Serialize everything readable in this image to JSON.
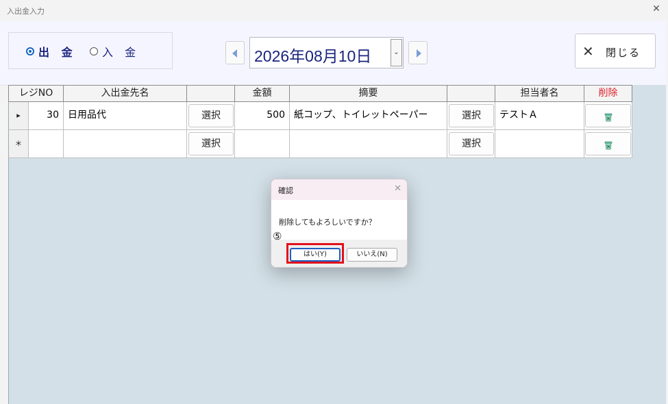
{
  "window": {
    "title": "入出金入力",
    "close_glyph": "✕"
  },
  "mode": {
    "options": [
      {
        "label": "出 金",
        "selected": true
      },
      {
        "label": "入 金",
        "selected": false
      }
    ]
  },
  "date": {
    "value": "2026年08月10日",
    "dropdown_glyph": "⌄"
  },
  "close_button": {
    "icon": "close-icon",
    "glyph": "✕",
    "label": "閉じる"
  },
  "table": {
    "headers": [
      "レジNO",
      "入出金先名",
      "",
      "金額",
      "摘要",
      "",
      "担当者名",
      "削除"
    ],
    "delete_header_color": "#e0202a",
    "select_label": "選択",
    "rows": [
      {
        "marker": "▸",
        "reg_no": "30",
        "name": "日用品代",
        "amount": "500",
        "summary": "紙コップ、トイレットペーパー",
        "staff": "テストＡ"
      },
      {
        "marker": "＊",
        "reg_no": "",
        "name": "",
        "amount": "",
        "summary": "",
        "staff": ""
      }
    ]
  },
  "dialog": {
    "title": "確認",
    "close_glyph": "✕",
    "message": "削除してもよろしいですか？",
    "yes_label": "はい(Y)",
    "no_label": "いいえ(N)"
  },
  "annotation": {
    "step": "⑤",
    "highlight_color": "#e3101c"
  }
}
